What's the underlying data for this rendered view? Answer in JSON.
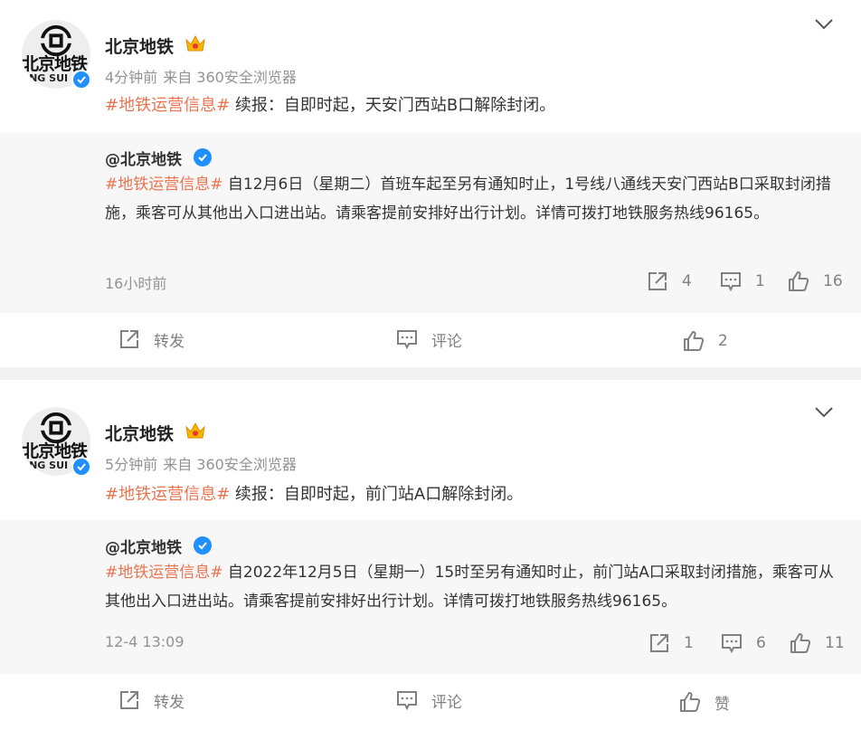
{
  "posts": [
    {
      "author": "北京地铁",
      "avatar_text": "北京地铁",
      "avatar_en": "ING SUI",
      "time": "4分钟前",
      "source": "来自 360安全浏览器",
      "tag": "#地铁运营信息#",
      "text": " 续报：自即时起，天安门西站B口解除封闭。",
      "repost": {
        "author": "@北京地铁",
        "tag": "#地铁运营信息#",
        "text": " 自12月6日（星期二）首班车起至另有通知时止，1号线八通线天安门西站B口采取封闭措施，乘客可从其他出入口进出站。请乘客提前安排好出行计划。详情可拨打地铁服务热线96165。",
        "time": "16小时前",
        "reposts": "4",
        "comments": "1",
        "likes": "16"
      },
      "actions": {
        "repost": "转发",
        "comment": "评论",
        "like": "2"
      }
    },
    {
      "author": "北京地铁",
      "avatar_text": "北京地铁",
      "avatar_en": "ING SUI",
      "time": "5分钟前",
      "source": "来自 360安全浏览器",
      "tag": "#地铁运营信息#",
      "text": " 续报：自即时起，前门站A口解除封闭。",
      "repost": {
        "author": "@北京地铁",
        "tag": "#地铁运营信息#",
        "text": " 自2022年12月5日（星期一）15时至另有通知时止，前门站A口采取封闭措施，乘客可从其他出入口进出站。请乘客提前安排好出行计划。详情可拨打地铁服务热线96165。",
        "time": "12-4 13:09",
        "reposts": "1",
        "comments": "6",
        "likes": "11"
      },
      "actions": {
        "repost": "转发",
        "comment": "评论",
        "like": "赞"
      }
    }
  ],
  "colors": {
    "tag": "#eb7350",
    "verified": "#1e90ff",
    "meta": "#939393",
    "repost_bg": "#f7f7f7"
  },
  "icons": [
    "chevron-down-icon",
    "crown-icon",
    "verified-icon",
    "repost-icon",
    "comment-icon",
    "like-icon"
  ]
}
